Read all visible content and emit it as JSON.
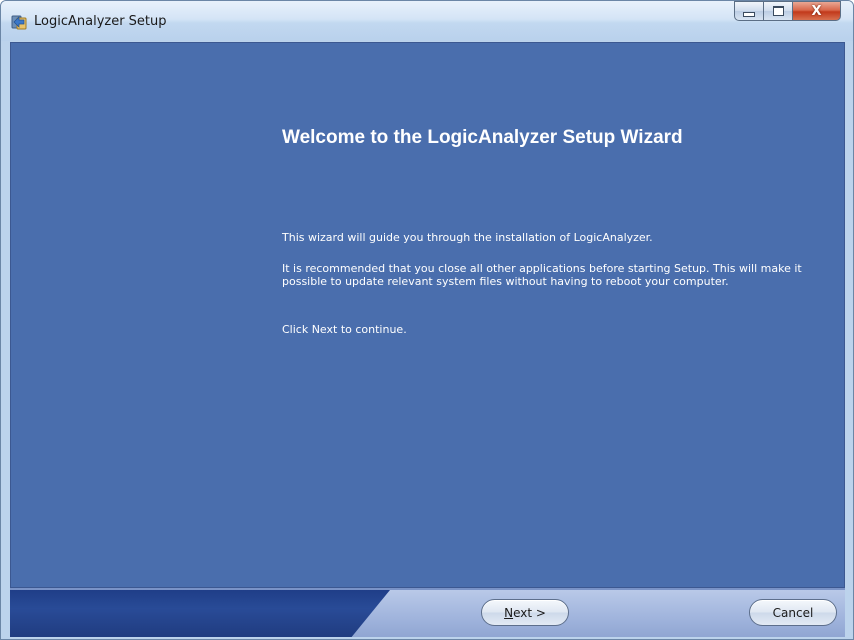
{
  "window": {
    "title": "LogicAnalyzer Setup",
    "controls": {
      "minimize": "minimize",
      "maximize": "maximize",
      "close": "X"
    }
  },
  "wizard": {
    "heading": "Welcome to the LogicAnalyzer Setup Wizard",
    "intro": "This wizard will guide you through the installation of LogicAnalyzer.",
    "recommendation": "It is recommended that you close all other applications before starting Setup. This will make it possible to update relevant system files without having to reboot your computer.",
    "continue_hint": "Click Next to continue."
  },
  "buttons": {
    "next_accel": "N",
    "next_rest": "ext >",
    "cancel": "Cancel"
  },
  "colors": {
    "panel_bg": "#4a6ead",
    "footer_bg": "#294b97",
    "text": "#ffffff"
  },
  "icons": {
    "app": "setup-installer-icon",
    "minimize": "minimize-icon",
    "maximize": "maximize-icon",
    "close": "close-icon"
  }
}
